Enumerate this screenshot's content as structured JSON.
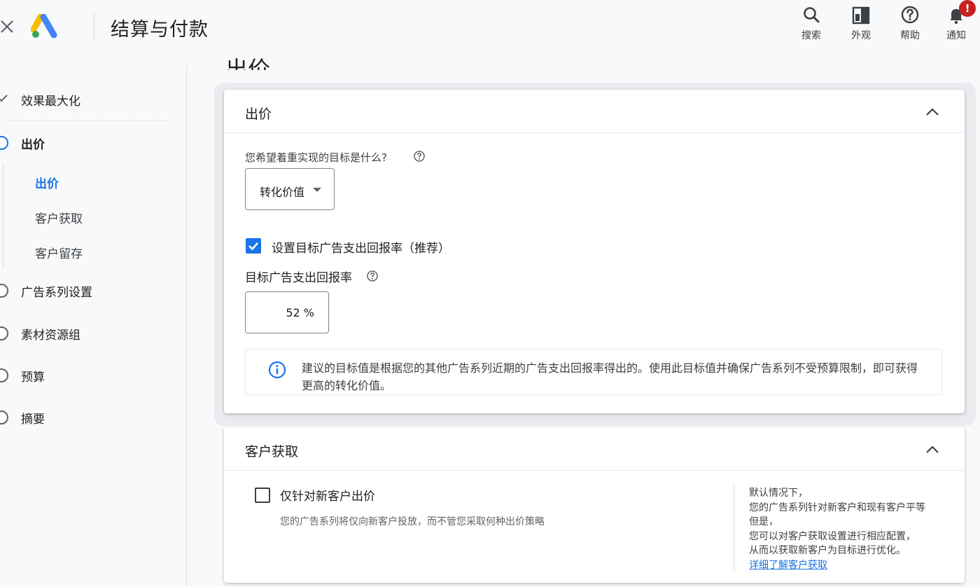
{
  "header": {
    "title": "结算与付款",
    "actions": [
      {
        "icon": "search-icon",
        "label": "搜索"
      },
      {
        "icon": "appearance-icon",
        "label": "外观"
      },
      {
        "icon": "help-icon",
        "label": "帮助"
      },
      {
        "icon": "bell-icon",
        "label": "通知",
        "badge": "!"
      }
    ]
  },
  "sidebar": {
    "steps": [
      {
        "label": "效果最大化",
        "state": "done"
      },
      {
        "label": "出价",
        "state": "active"
      },
      {
        "label": "广告系列设置",
        "state": "pending"
      },
      {
        "label": "素材资源组",
        "state": "pending"
      },
      {
        "label": "预算",
        "state": "pending"
      },
      {
        "label": "摘要",
        "state": "pending"
      }
    ],
    "substeps": [
      {
        "label": "出价",
        "active": true
      },
      {
        "label": "客户获取",
        "active": false
      },
      {
        "label": "客户留存",
        "active": false
      }
    ]
  },
  "main": {
    "section_heading": "出价",
    "bidding_card": {
      "title": "出价",
      "question": "您希望着重实现的目标是什么?",
      "goal_value": "转化价值",
      "target_roas_checkbox_label": "设置目标广告支出回报率（推荐）",
      "target_roas_checked": true,
      "target_roas_label": "目标广告支出回报率",
      "target_roas_value": "52 %",
      "info_text": "建议的目标值是根据您的其他广告系列近期的广告支出回报率得出的。使用此目标值并确保广告系列不受预算限制，即可获得更高的转化价值。"
    },
    "acquisition_card": {
      "title": "客户获取",
      "checkbox_label": "仅针对新客户出价",
      "checked": false,
      "description": "您的广告系列将仅向新客户投放，而不管您采取何种出价策略",
      "side_lines": [
        "默认情况下，",
        "您的广告系列针对新客户和现有客户平等",
        "但是，",
        "您可以对客户获取设置进行相应配置，",
        "从而以获取新客户为目标进行优化。"
      ],
      "learn_more_link": "详细了解客户获取"
    }
  },
  "colors": {
    "accent": "#1a73e8",
    "badge": "#c5221f",
    "text": "#202124",
    "muted": "#5f6368"
  }
}
